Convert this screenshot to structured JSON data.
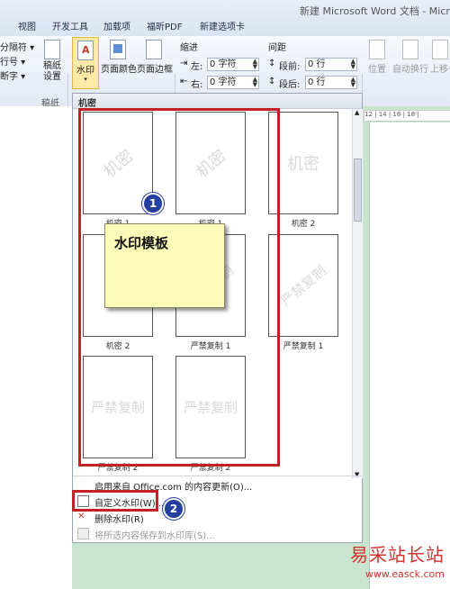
{
  "window": {
    "title": "新建 Microsoft Word 文档 - Microso"
  },
  "tabs": [
    "视图",
    "开发工具",
    "加载项",
    "福昕PDF",
    "新建选项卡"
  ],
  "ribbon": {
    "left_items": [
      "分隔符 ▾",
      "行号 ▾",
      "断字 ▾"
    ],
    "draft_button": "稿纸\n设置",
    "draft_group_label": "稿纸",
    "watermark_button": "水印",
    "page_color_button": "页面颜色",
    "page_border_button": "页面边框",
    "indent_label": "缩进",
    "indent_left_label": "左:",
    "indent_left_value": "0 字符",
    "indent_right_label": "右:",
    "indent_right_value": "0 字符",
    "spacing_label": "间距",
    "spacing_before_label": "段前:",
    "spacing_before_value": "0 行",
    "spacing_after_label": "段后:",
    "spacing_after_value": "0 行",
    "position_button": "位置",
    "wrap_button": "自动换行",
    "forward_button": "上移一"
  },
  "gallery": {
    "header": "机密",
    "thumbnails": [
      {
        "watermark": "机密",
        "caption": "机密 1",
        "diagonal": true
      },
      {
        "watermark": "机密",
        "caption": "机密 1",
        "diagonal": true
      },
      {
        "watermark": "机密",
        "caption": "机密 2",
        "diagonal": false
      },
      {
        "watermark": "机密",
        "caption": "机密 2",
        "diagonal": true
      },
      {
        "watermark": "严禁复制",
        "caption": "严禁复制 1",
        "diagonal": true
      },
      {
        "watermark": "严禁复制",
        "caption": "严禁复制 1",
        "diagonal": true
      },
      {
        "watermark": "严禁复制",
        "caption": "严禁复制 2",
        "diagonal": false
      },
      {
        "watermark": "严禁复制",
        "caption": "严禁复制 2",
        "diagonal": false
      }
    ],
    "menu": {
      "office_update": "启用来自 Office.com 的内容更新(O)...",
      "custom_watermark": "自定义水印(W)...",
      "remove_watermark": "删除水印(R)",
      "save_selection": "将所选内容保存到水印库(S)..."
    }
  },
  "callouts": {
    "note_text": "水印模板",
    "badge1": "1",
    "badge2": "2"
  },
  "ruler_text": "12 | 14 | 16 | 18 |",
  "brand": {
    "name": "易采站长站",
    "url": "www.easck.com"
  },
  "colors": {
    "highlight_red": "#c42127",
    "badge_blue": "#243f9e",
    "note_yellow": "#fdfbb8",
    "doc_bg": "#c9e4cf"
  }
}
